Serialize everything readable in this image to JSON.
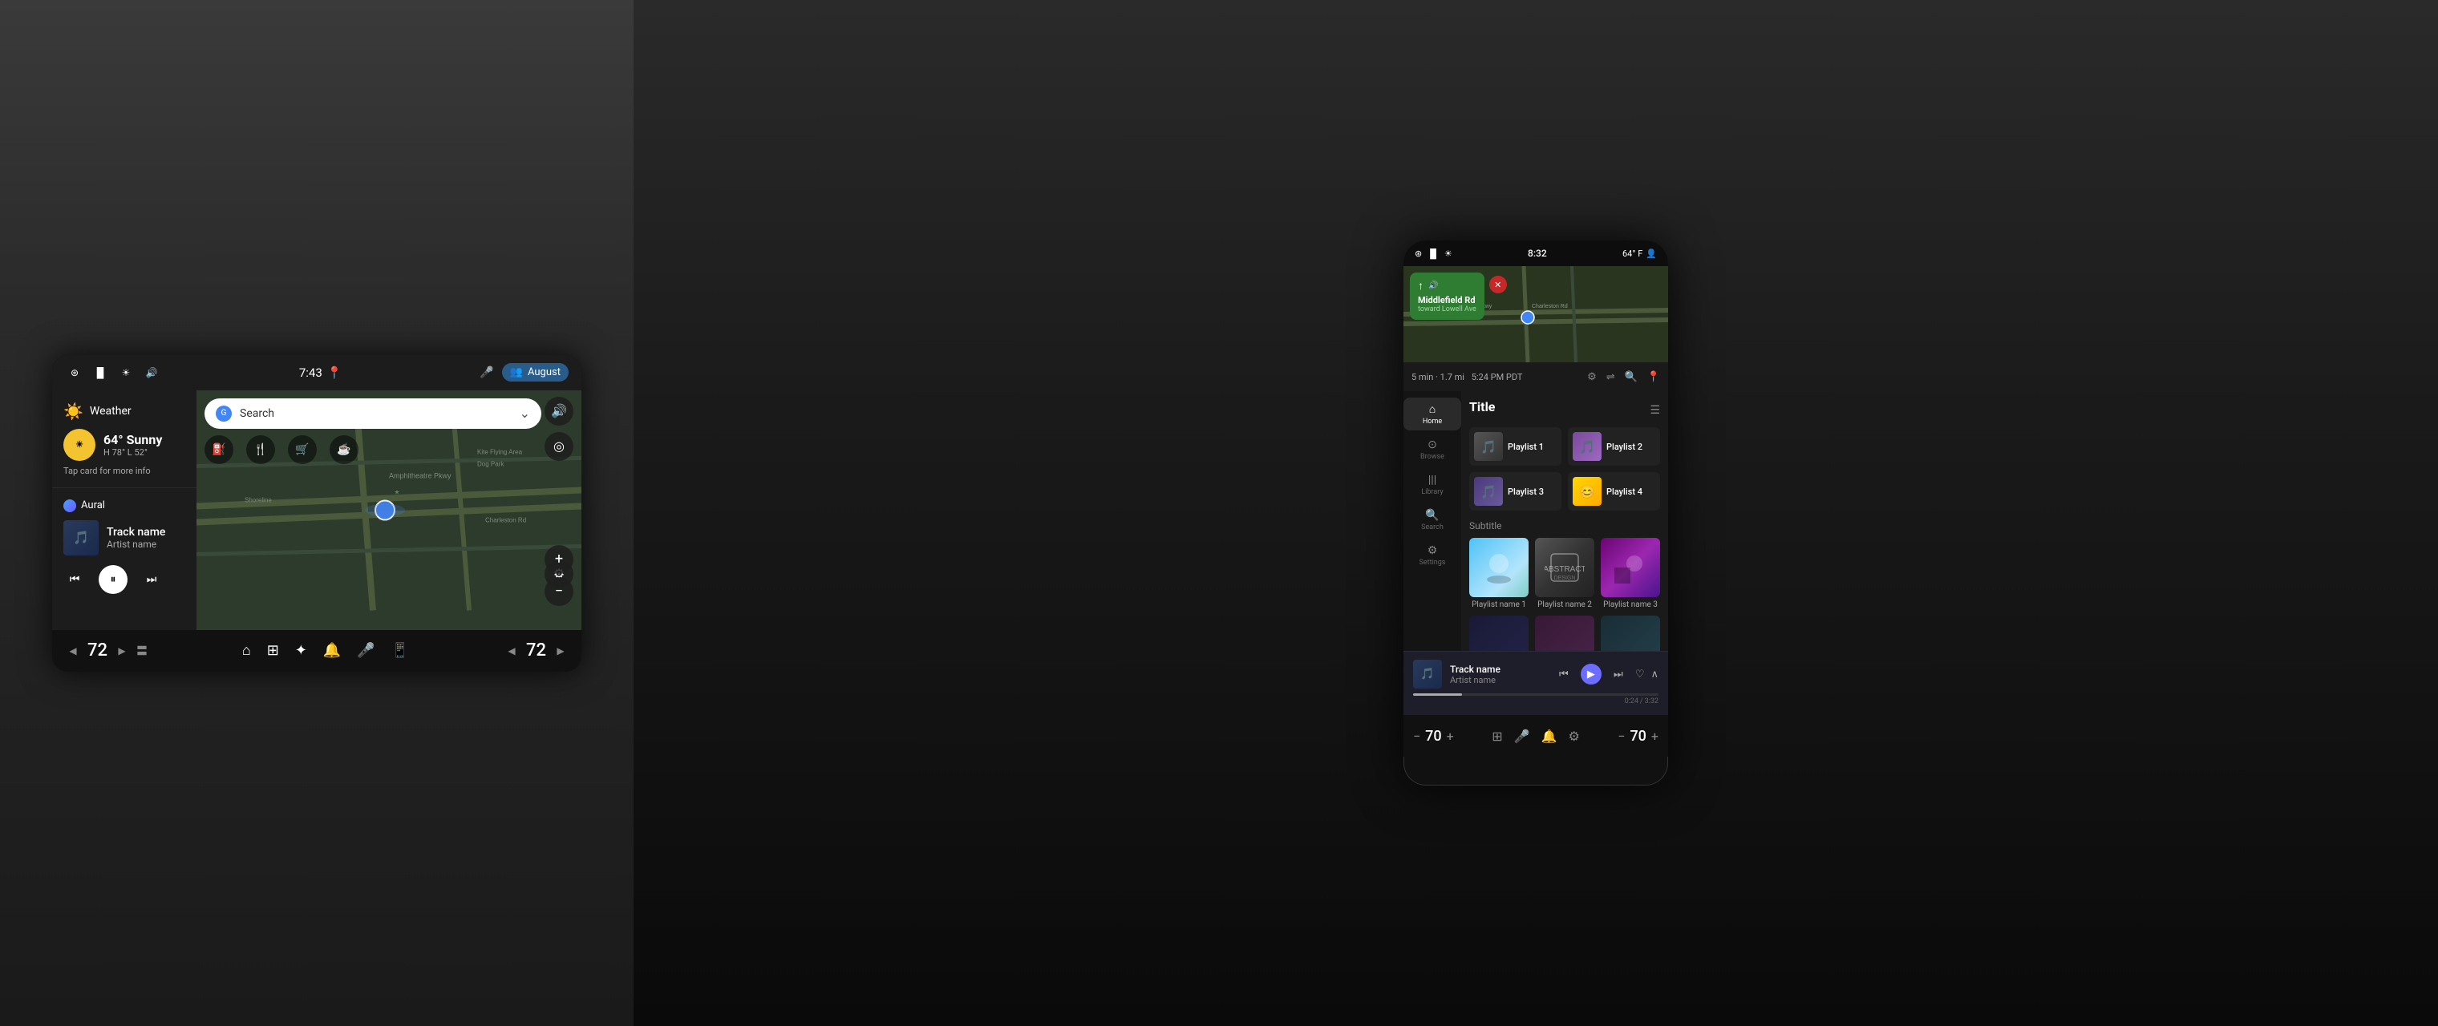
{
  "left": {
    "status": {
      "time": "7:43",
      "location_pin": "📍",
      "user_name": "August"
    },
    "weather": {
      "title": "Weather",
      "temperature": "64°",
      "condition": "Sunny",
      "high": "H 78°",
      "low": "L 52°",
      "tap_hint": "Tap card for more info"
    },
    "music": {
      "app_name": "Aural",
      "track_name": "Track name",
      "artist_name": "Artist name"
    },
    "player": {
      "prev_label": "⏮",
      "play_label": "⏸",
      "next_label": "⏭"
    },
    "map": {
      "search_placeholder": "Search"
    },
    "bottom": {
      "temp_left": "72",
      "temp_right": "72"
    }
  },
  "right": {
    "phone": {
      "status": {
        "time": "8:32",
        "temperature": "64° F"
      },
      "nav": {
        "street": "Middlefield Rd",
        "toward": "toward Lowell Ave",
        "eta": "5 min · 1.7 mi",
        "time_of_day": "5:24 PM PDT"
      },
      "sidebar": {
        "items": [
          {
            "label": "Home",
            "icon": "🏠"
          },
          {
            "label": "Browse",
            "icon": "🔍"
          },
          {
            "label": "Library",
            "icon": "📚"
          },
          {
            "label": "Search",
            "icon": "🔎"
          },
          {
            "label": "Settings",
            "icon": "⚙️"
          }
        ]
      },
      "content": {
        "title": "Title",
        "subtitle": "Subtitle",
        "playlists": [
          {
            "name": "Playlist 1",
            "style": "p1"
          },
          {
            "name": "Playlist 2",
            "style": "p2"
          },
          {
            "name": "Playlist 3",
            "style": "p3"
          },
          {
            "name": "Playlist 4",
            "style": "p4"
          }
        ],
        "big_playlists": [
          {
            "name": "Playlist name 1",
            "style": "bp1"
          },
          {
            "name": "Playlist name 2",
            "style": "bp2"
          },
          {
            "name": "Playlist name 3",
            "style": "bp3"
          }
        ]
      },
      "now_playing": {
        "track_name": "Track name",
        "artist_name": "Artist name",
        "progress": "0:24",
        "duration": "3:32"
      },
      "bottom": {
        "temp_left": "70",
        "temp_right": "70"
      }
    }
  }
}
